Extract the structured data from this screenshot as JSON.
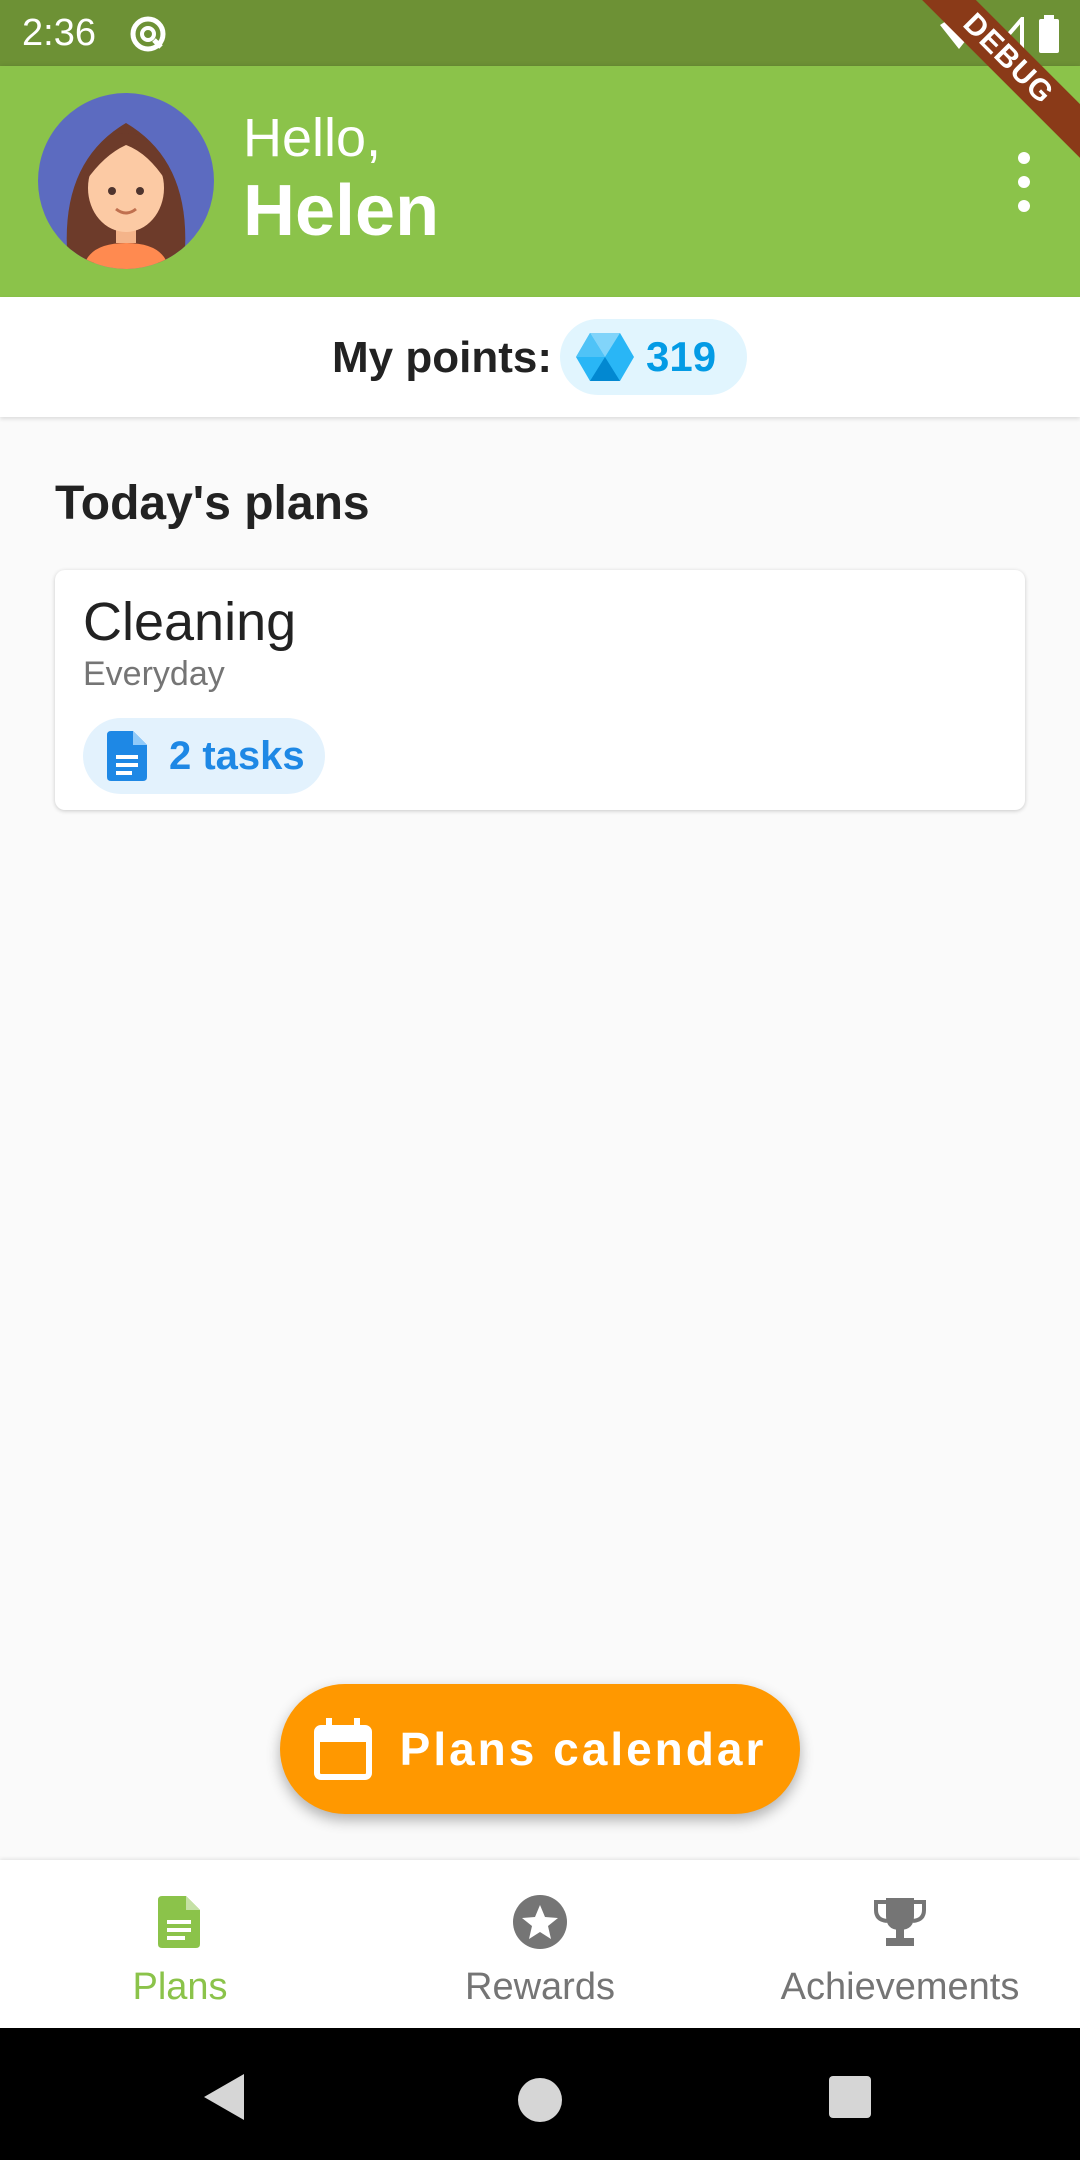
{
  "status_bar": {
    "time": "2:36",
    "icons": [
      "sync-icon",
      "wifi-icon",
      "signal-icon",
      "battery-icon"
    ]
  },
  "header": {
    "greeting": "Hello,",
    "user_name": "Helen",
    "debug_banner": "DEBUG",
    "menu_icon": "more-vert-icon",
    "bar_color": "#8bc34a"
  },
  "points": {
    "label": "My points:",
    "value": "319",
    "icon": "gem-icon"
  },
  "main": {
    "section_title": "Today's plans",
    "plans": [
      {
        "name": "Cleaning",
        "frequency": "Everyday",
        "tasks_label": "2 tasks",
        "icon": "document-icon"
      }
    ]
  },
  "fab": {
    "label": "Plans calendar",
    "icon": "calendar-icon",
    "color": "#ff9800"
  },
  "bottom_nav": {
    "items": [
      {
        "label": "Plans",
        "icon": "document-icon",
        "active": true
      },
      {
        "label": "Rewards",
        "icon": "star-icon",
        "active": false
      },
      {
        "label": "Achievements",
        "icon": "trophy-icon",
        "active": false
      }
    ],
    "active_color": "#8bc34a"
  }
}
